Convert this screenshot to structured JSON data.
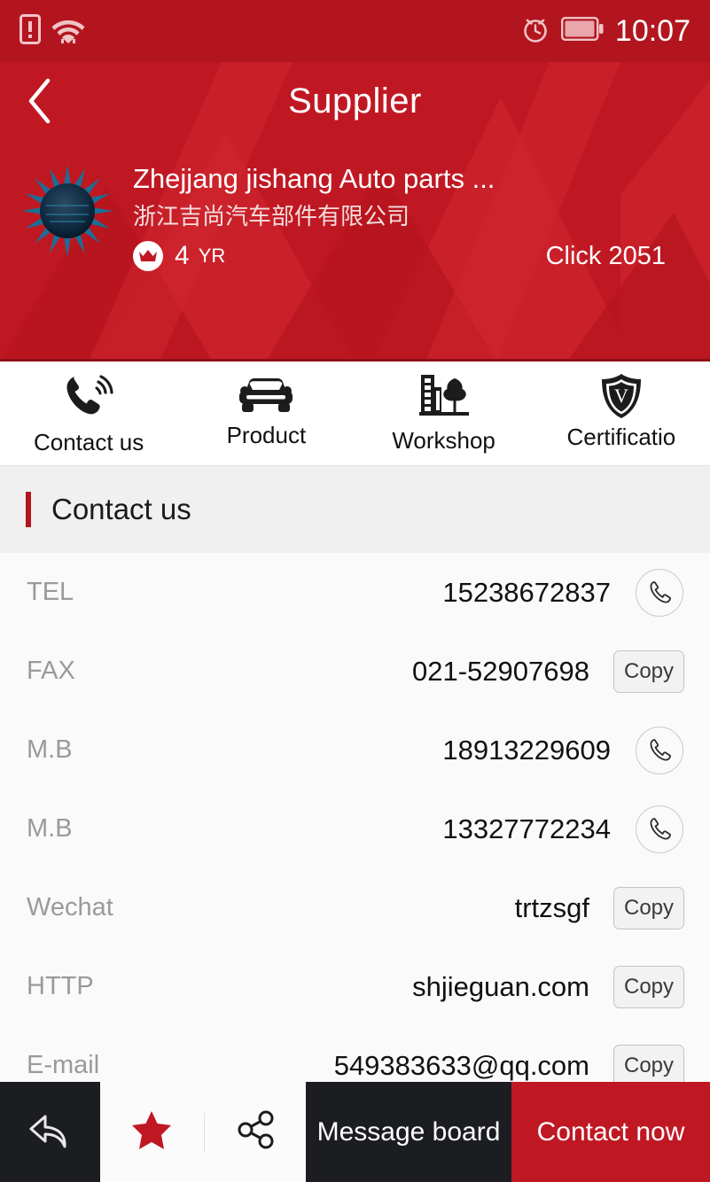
{
  "statusbar": {
    "time": "10:07",
    "icons": [
      "sim-card-alert-icon",
      "wifi-icon",
      "alarm-icon",
      "battery-icon"
    ]
  },
  "header": {
    "back_icon": "back-chevron-icon",
    "title": "Supplier",
    "bg_color": "#c01823"
  },
  "company": {
    "name_en": "Zhejjang jishang Auto parts ...",
    "name_cn": "浙江吉尚汽车部件有限公司",
    "years": "4",
    "years_unit": "YR",
    "badge_icon": "crown-icon",
    "clicks": "Click 2051",
    "avatar_icon": "spiky-ball-avatar"
  },
  "tabs": [
    {
      "label": "Contact us",
      "icon": "phone-ringing-icon"
    },
    {
      "label": "Product",
      "icon": "car-icon"
    },
    {
      "label": "Workshop",
      "icon": "factory-tree-icon"
    },
    {
      "label": "Certificatio",
      "icon": "shield-v-icon"
    }
  ],
  "section": {
    "title": "Contact us",
    "accent_color": "#b3151f"
  },
  "contacts": [
    {
      "label": "TEL",
      "value": "15238672837",
      "action": "call",
      "action_label": "",
      "icon": "phone-icon"
    },
    {
      "label": "FAX",
      "value": "021-52907698",
      "action": "copy",
      "action_label": "Copy",
      "icon": ""
    },
    {
      "label": "M.B",
      "value": "18913229609",
      "action": "call",
      "action_label": "",
      "icon": "phone-icon"
    },
    {
      "label": "M.B",
      "value": "13327772234",
      "action": "call",
      "action_label": "",
      "icon": "phone-icon"
    },
    {
      "label": "Wechat",
      "value": "trtzsgf",
      "action": "copy",
      "action_label": "Copy",
      "icon": ""
    },
    {
      "label": "HTTP",
      "value": "shjieguan.com",
      "action": "copy",
      "action_label": "Copy",
      "icon": ""
    },
    {
      "label": "E-mail",
      "value": "549383633@qq.com",
      "action": "copy",
      "action_label": "Copy",
      "icon": ""
    }
  ],
  "bottombar": {
    "back_icon": "reply-arrow-icon",
    "favorite_icon": "star-icon",
    "share_icon": "share-icon",
    "message_label": "Message board",
    "contact_label": "Contact now",
    "favorite_color": "#c01823",
    "contact_bg": "#c01823"
  }
}
